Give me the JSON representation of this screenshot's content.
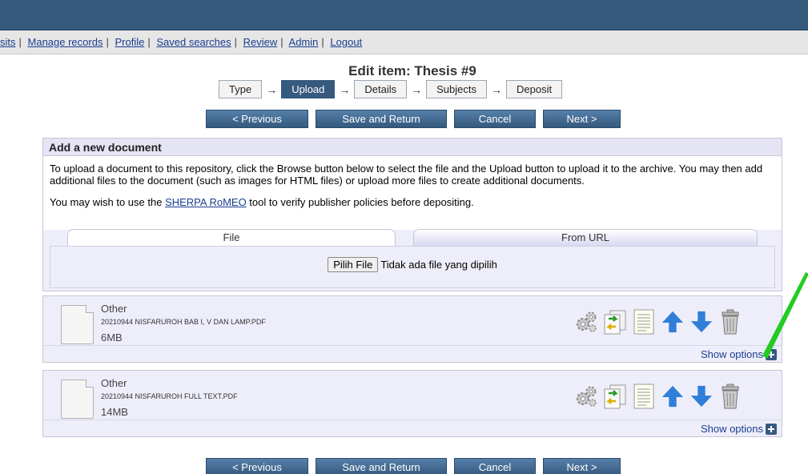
{
  "nav": {
    "items": [
      "sits",
      "Manage records",
      "Profile",
      "Saved searches",
      "Review",
      "Admin",
      "Logout"
    ]
  },
  "page_title": "Edit item: Thesis #9",
  "steps": [
    "Type",
    "Upload",
    "Details",
    "Subjects",
    "Deposit"
  ],
  "active_step": "Upload",
  "buttons": {
    "previous": "< Previous",
    "save_return": "Save and Return",
    "cancel": "Cancel",
    "next": "Next >"
  },
  "add_document": {
    "heading": "Add a new document",
    "instructions": "To upload a document to this repository, click the Browse button below to select the file and the Upload button to upload it to the archive. You may then add additional files to the document (such as images for HTML files) or upload more files to create additional documents.",
    "sherpa_prefix": "You may wish to use the ",
    "sherpa_link": "SHERPA RoMEO",
    "sherpa_suffix": " tool to verify publisher policies before depositing.",
    "tab_file": "File",
    "tab_url": "From URL",
    "choose_file_button": "Pilih File",
    "no_file_text": "Tidak ada file yang dipilih"
  },
  "documents": [
    {
      "type": "Other",
      "filename": "20210944 NISFARUROH BAB I, V DAN LAMP.PDF",
      "size": "6MB",
      "show_options": "Show options"
    },
    {
      "type": "Other",
      "filename": "20210944 NISFARUROH FULL TEXT.PDF",
      "size": "14MB",
      "show_options": "Show options"
    }
  ],
  "colors": {
    "header": "#36597e",
    "button": "#36597e",
    "panel_bg": "#eeeefa",
    "arrow_blue": "#2f7fd8",
    "annotation": "#22cc22"
  },
  "icons": [
    "gears-icon",
    "convert-icon",
    "document-icon",
    "up-arrow-icon",
    "down-arrow-icon",
    "trash-icon",
    "plus-icon"
  ]
}
